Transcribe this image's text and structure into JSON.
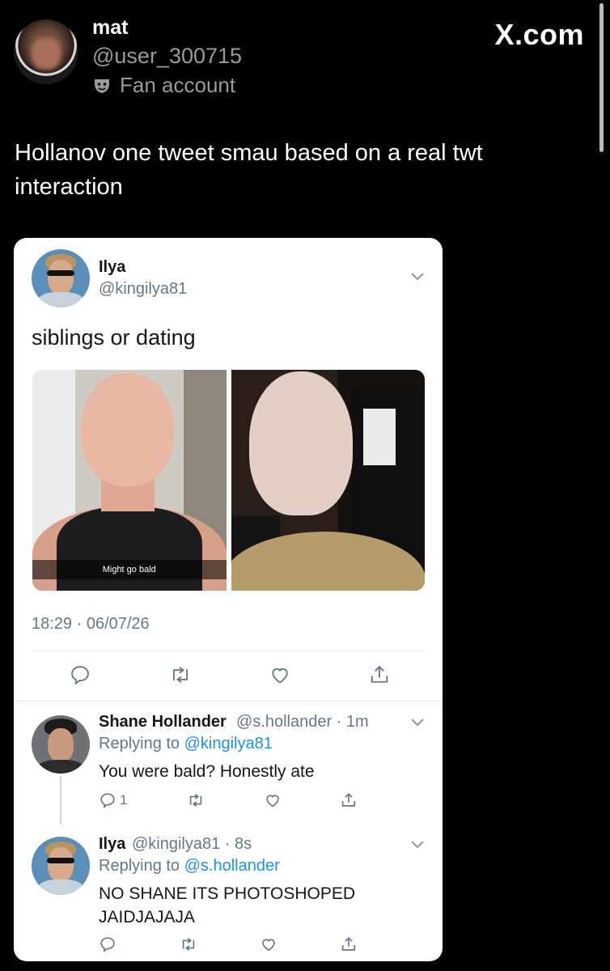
{
  "outer": {
    "display_name": "mat",
    "handle": "@user_300715",
    "badge_label": "Fan account",
    "brand": "X.com",
    "post_text": "Hollanov one tweet smau based on a real twt interaction"
  },
  "embedded": {
    "main_tweet": {
      "name": "Ilya",
      "handle": "@kingilya81",
      "text": "siblings or dating",
      "photo_caption": "Might go bald",
      "timestamp": "18:29 · 06/07/26"
    },
    "reply1": {
      "name": "Shane Hollander",
      "handle_time": "@s.hollander · 1m",
      "replying_prefix": "Replying to",
      "replying_to": "@kingilya81",
      "text": "You were bald? Honestly ate",
      "reply_count": "1"
    },
    "reply2": {
      "name": "Ilya",
      "handle_time": "@kingilya81 · 8s",
      "replying_prefix": "Replying to",
      "replying_to": "@s.hollander",
      "text_line1": "NO SHANE ITS PHOTOSHOPED",
      "text_line2": "JAIDJAJAJA"
    }
  },
  "icons": [
    "mask-icon",
    "chevron-down-icon",
    "reply-icon",
    "retweet-icon",
    "like-icon",
    "share-icon"
  ],
  "colors": {
    "background": "#000000",
    "card": "#ffffff",
    "muted": "#657786",
    "link": "#1b95e0",
    "outer_muted": "#9a9a9a"
  }
}
